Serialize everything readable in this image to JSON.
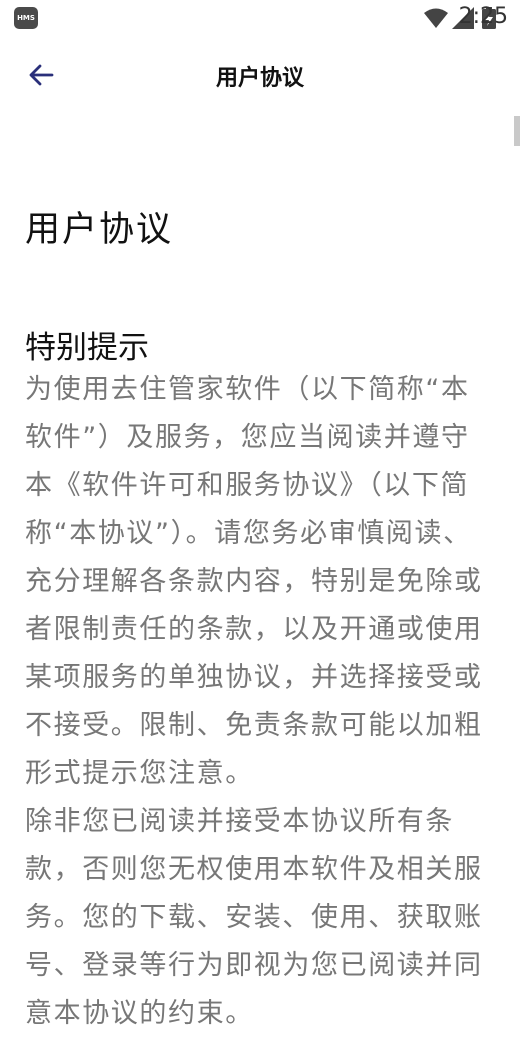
{
  "status_bar": {
    "hms_badge": "HMS",
    "time": "2:25",
    "icons": [
      "wifi-icon",
      "signal-icon",
      "battery-charging-icon"
    ]
  },
  "app_bar": {
    "back_icon": "arrow-left-icon",
    "title": "用户协议"
  },
  "document": {
    "title": "用户协议",
    "section_title": "特别提示",
    "paragraph_1": "为使用去住管家软件（以下简称“本软件”）及服务，您应当阅读并遵守本《软件许可和服务协议》（以下简称“本协议”）。请您务必审慎阅读、充分理解各条款内容，特别是免除或者限制责任的条款，以及开通或使用某项服务的单独协议，并选择接受或不接受。限制、免责条款可能以加粗形式提示您注意。",
    "paragraph_2": "除非您已阅读并接受本协议所有条款，否则您无权使用本软件及相关服务。您的下载、安装、使用、获取账号、登录等行为即视为您已阅读并同意本协议的约束。"
  },
  "colors": {
    "background": "#ffffff",
    "heading_text": "#111111",
    "body_text": "#777777",
    "back_arrow": "#2a2f7a",
    "scrollbar": "#c9c9c9"
  }
}
